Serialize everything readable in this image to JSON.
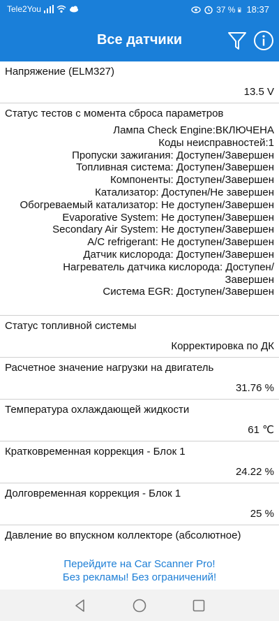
{
  "status_bar": {
    "carrier": "Tele2You",
    "battery": "37 %",
    "time": "18:37"
  },
  "app_bar": {
    "title": "Все датчики"
  },
  "sensors": [
    {
      "title": "Напряжение (ELM327)",
      "value": "13.5 V"
    },
    {
      "title": "Статус тестов с момента сброса параметров",
      "lines": [
        "Лампа Check Engine:ВКЛЮЧЕНА",
        "Коды неисправностей:1",
        "Пропуски зажигания: Доступен/Завершен",
        "Топливная система: Доступен/Завершен",
        "Компоненты: Доступен/Завершен",
        "Катализатор: Доступен/Не завершен",
        "Обогреваемый катализатор: Не доступен/Завершен",
        "Evaporative System: Не доступен/Завершен",
        "Secondary Air System: Не доступен/Завершен",
        "A/C refrigerant: Не доступен/Завершен",
        "Датчик кислорода: Доступен/Завершен",
        "Нагреватель датчика кислорода: Доступен/",
        "Завершен",
        "Система EGR: Доступен/Завершен"
      ]
    },
    {
      "title": "Статус топливной системы",
      "value": "Корректировка по ДК"
    },
    {
      "title": "Расчетное значение нагрузки на двигатель",
      "value": "31.76 %"
    },
    {
      "title": "Температура охлаждающей жидкости",
      "value": "61 ℃"
    },
    {
      "title": "Кратковременная коррекция - Блок 1",
      "value": "24.22 %"
    },
    {
      "title": "Долговременная коррекция - Блок 1",
      "value": "25 %"
    },
    {
      "title": "Давление во впускном коллекторе (абсолютное)",
      "value": ""
    }
  ],
  "promo": {
    "line1": "Перейдите на Car Scanner Pro!",
    "line2": "Без рекламы! Без ограничений!"
  }
}
